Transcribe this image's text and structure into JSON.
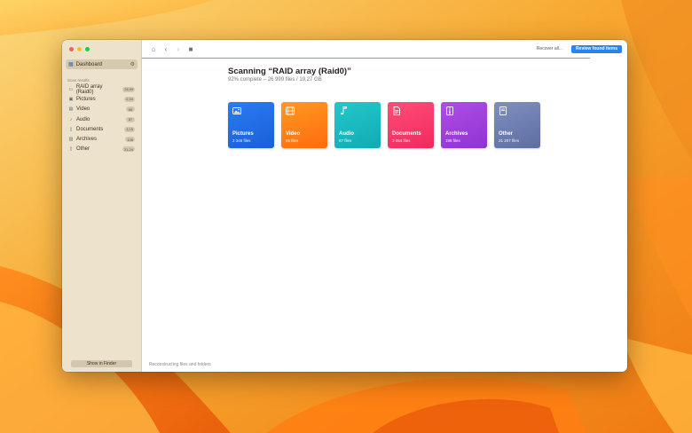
{
  "sidebar": {
    "dashboard_label": "Dashboard",
    "section_title": "Scan results",
    "items": [
      {
        "label": "RAID array (Raid0)",
        "badge": "26,99",
        "icon": "hard-drive-icon"
      },
      {
        "label": "Pictures",
        "badge": "2,34",
        "icon": "picture-icon"
      },
      {
        "label": "Video",
        "badge": "66",
        "icon": "film-icon"
      },
      {
        "label": "Audio",
        "badge": "87",
        "icon": "music-note-icon"
      },
      {
        "label": "Documents",
        "badge": "3,15",
        "icon": "document-icon"
      },
      {
        "label": "Archives",
        "badge": "108",
        "icon": "archive-icon"
      },
      {
        "label": "Other",
        "badge": "21,24",
        "icon": "file-icon"
      }
    ],
    "show_in_finder": "Show in Finder"
  },
  "toolbar": {
    "recover_all": "Recover all...",
    "review_found": "Review found items"
  },
  "scan": {
    "title": "Scanning “RAID array (Raid0)”",
    "subtitle": "92% complete – 26 999 files / 19,27 GB",
    "progress": 0.92
  },
  "tiles": [
    {
      "name": "Pictures",
      "count": "2 346 files",
      "color_top": "#2a7cf6",
      "color_bottom": "#1a5fd6",
      "icon": "picture-icon"
    },
    {
      "name": "Video",
      "count": "66 files",
      "color_top": "#ff9a1f",
      "color_bottom": "#ff6a10",
      "icon": "film-icon"
    },
    {
      "name": "Audio",
      "count": "87 files",
      "color_top": "#22c8cc",
      "color_bottom": "#12aab4",
      "icon": "music-note-icon"
    },
    {
      "name": "Documents",
      "count": "3 054 files",
      "color_top": "#ff4d7a",
      "color_bottom": "#f02a5c",
      "icon": "document-icon"
    },
    {
      "name": "Archives",
      "count": "196 files",
      "color_top": "#b04de6",
      "color_bottom": "#8e34d2",
      "icon": "archive-icon"
    },
    {
      "name": "Other",
      "count": "21 207 files",
      "color_top": "#7f8fc0",
      "color_bottom": "#5e6ea0",
      "icon": "file-icon"
    }
  ],
  "status_text": "Reconstructing files and folders"
}
